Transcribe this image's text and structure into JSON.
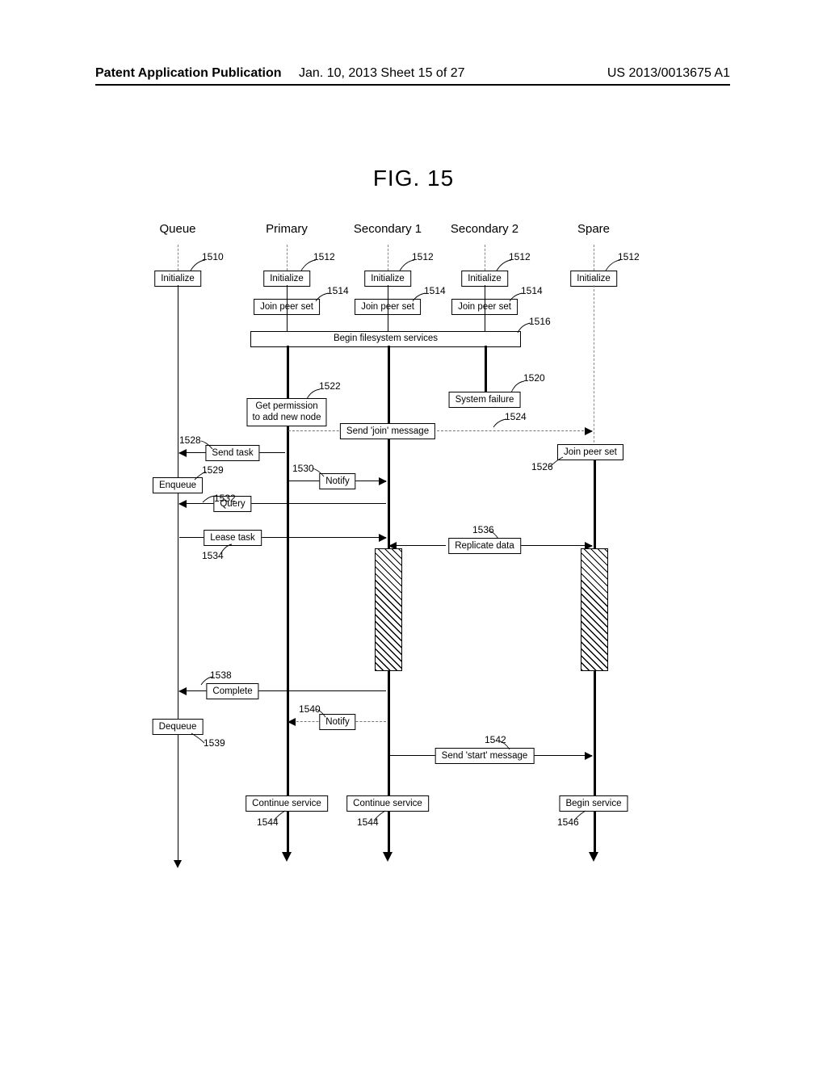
{
  "header": {
    "left": "Patent Application Publication",
    "mid": "Jan. 10, 2013  Sheet 15 of 27",
    "right": "US 2013/0013675 A1"
  },
  "figure_title": "FIG. 15",
  "lanes": {
    "queue": "Queue",
    "primary": "Primary",
    "sec1": "Secondary 1",
    "sec2": "Secondary 2",
    "spare": "Spare"
  },
  "boxes": {
    "initialize": "Initialize",
    "join_peer_set": "Join peer set",
    "begin_fs": "Begin filesystem services",
    "system_failure": "System failure",
    "get_permission_1": "Get permission",
    "get_permission_2": "to add new node",
    "send_join": "Send 'join' message",
    "send_task": "Send task",
    "enqueue": "Enqueue",
    "notify": "Notify",
    "query": "Query",
    "lease_task": "Lease task",
    "replicate": "Replicate data",
    "complete": "Complete",
    "dequeue": "Dequeue",
    "send_start": "Send 'start' message",
    "continue_service": "Continue service",
    "begin_service": "Begin service"
  },
  "refs": {
    "r1510": "1510",
    "r1512": "1512",
    "r1514": "1514",
    "r1516": "1516",
    "r1520": "1520",
    "r1522": "1522",
    "r1524": "1524",
    "r1526": "1526",
    "r1528": "1528",
    "r1529": "1529",
    "r1530": "1530",
    "r1532": "1532",
    "r1534": "1534",
    "r1536": "1536",
    "r1538": "1538",
    "r1539": "1539",
    "r1540": "1540",
    "r1542": "1542",
    "r1544": "1544",
    "r1546": "1546"
  },
  "chart_data": {
    "type": "sequence",
    "title": "FIG. 15",
    "lanes": [
      "Queue",
      "Primary",
      "Secondary 1",
      "Secondary 2",
      "Spare"
    ],
    "events": [
      {
        "ref": 1510,
        "lane": "Queue",
        "label": "Initialize"
      },
      {
        "ref": 1512,
        "lane": "Primary",
        "label": "Initialize"
      },
      {
        "ref": 1512,
        "lane": "Secondary 1",
        "label": "Initialize"
      },
      {
        "ref": 1512,
        "lane": "Secondary 2",
        "label": "Initialize"
      },
      {
        "ref": 1512,
        "lane": "Spare",
        "label": "Initialize"
      },
      {
        "ref": 1514,
        "lane": "Primary",
        "label": "Join peer set"
      },
      {
        "ref": 1514,
        "lane": "Secondary 1",
        "label": "Join peer set"
      },
      {
        "ref": 1514,
        "lane": "Secondary 2",
        "label": "Join peer set"
      },
      {
        "ref": 1516,
        "span": [
          "Primary",
          "Secondary 2"
        ],
        "label": "Begin filesystem services"
      },
      {
        "ref": 1520,
        "lane": "Secondary 2",
        "label": "System failure"
      },
      {
        "ref": 1522,
        "lane": "Primary",
        "label": "Get permission to add new node"
      },
      {
        "ref": 1524,
        "from": "Secondary 1",
        "to": "Spare",
        "label": "Send 'join' message"
      },
      {
        "ref": 1526,
        "lane": "Spare",
        "label": "Join peer set"
      },
      {
        "ref": 1528,
        "from": "Primary",
        "to": "Queue",
        "label": "Send task"
      },
      {
        "ref": 1529,
        "lane": "Queue",
        "label": "Enqueue"
      },
      {
        "ref": 1530,
        "from": "Primary",
        "to": "Secondary 1",
        "label": "Notify"
      },
      {
        "ref": 1532,
        "from": "Secondary 1",
        "to": "Queue",
        "label": "Query"
      },
      {
        "ref": 1534,
        "from": "Queue",
        "to": "Secondary 1",
        "label": "Lease task"
      },
      {
        "ref": 1536,
        "from": "Secondary 1",
        "to": [
          "Secondary 1",
          "Spare"
        ],
        "label": "Replicate data"
      },
      {
        "ref": 1538,
        "from": "Secondary 1",
        "to": "Queue",
        "label": "Complete"
      },
      {
        "ref": 1539,
        "lane": "Queue",
        "label": "Dequeue"
      },
      {
        "ref": 1540,
        "from": "Primary",
        "to": "Secondary 1",
        "style": "dashed",
        "label": "Notify"
      },
      {
        "ref": 1542,
        "from": "Secondary 1",
        "to": "Spare",
        "label": "Send 'start' message"
      },
      {
        "ref": 1544,
        "lane": "Primary",
        "label": "Continue service"
      },
      {
        "ref": 1544,
        "lane": "Secondary 1",
        "label": "Continue service"
      },
      {
        "ref": 1546,
        "lane": "Spare",
        "label": "Begin service"
      }
    ]
  }
}
